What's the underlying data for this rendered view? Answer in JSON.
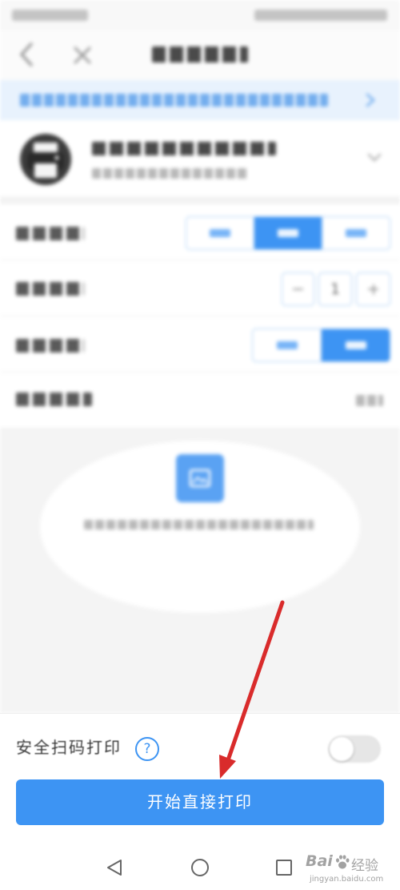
{
  "colors": {
    "accent": "#3d94f3",
    "annotation": "#d92b2b",
    "banner_bg": "#e8f2fd",
    "preview_bg": "#f4f4f4"
  },
  "header": {
    "back_icon": "chevron-left-icon",
    "close_icon": "close-icon"
  },
  "banner": {
    "icon": "chevron-right-icon"
  },
  "printer": {
    "icon": "printer-icon",
    "expand_icon": "chevron-down-icon"
  },
  "size_selector": {
    "segments": [
      {
        "selected": false
      },
      {
        "selected": true
      },
      {
        "selected": false
      }
    ]
  },
  "copies": {
    "value": "1",
    "minus_icon": "minus-icon",
    "plus_icon": "plus-icon"
  },
  "duplex_selector": {
    "segments": [
      {
        "selected": false
      },
      {
        "selected": true
      }
    ]
  },
  "preview": {
    "icon": "image-icon"
  },
  "safe_scan": {
    "label": "安全扫码打印",
    "help_glyph": "?",
    "help_icon": "question-circle-icon",
    "toggle_on": false
  },
  "primary_button": {
    "label": "开始直接打印"
  },
  "system_nav": {
    "back_icon": "triangle-back-icon",
    "home_icon": "circle-home-icon",
    "recents_icon": "square-recents-icon"
  },
  "watermark": {
    "brand": "Bai",
    "brand_suffix": "经验",
    "url": "jingyan.baidu.com",
    "icon": "paw-icon"
  }
}
